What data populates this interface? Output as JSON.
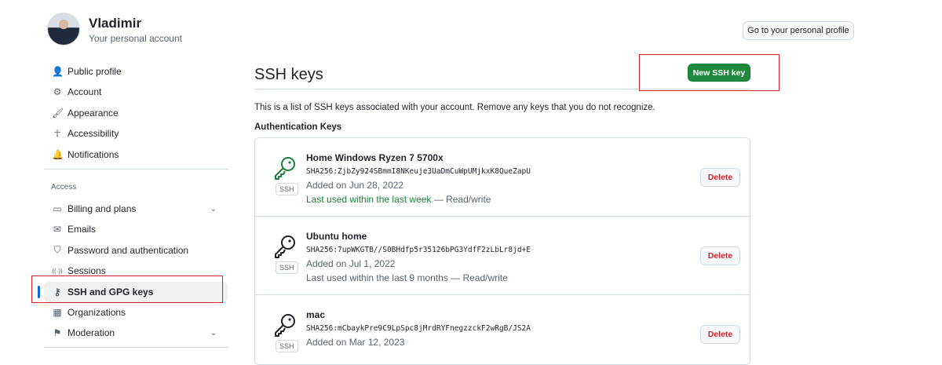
{
  "user": {
    "name": "Vladimir",
    "subtitle": "Your personal account"
  },
  "header": {
    "profile_button": "Go to your personal profile"
  },
  "sidebar": {
    "items": [
      {
        "label": "Public profile",
        "icon": "person-icon"
      },
      {
        "label": "Account",
        "icon": "gear-icon"
      },
      {
        "label": "Appearance",
        "icon": "paintbrush-icon"
      },
      {
        "label": "Accessibility",
        "icon": "accessibility-icon"
      },
      {
        "label": "Notifications",
        "icon": "bell-icon"
      }
    ],
    "section_label": "Access",
    "access_items": [
      {
        "label": "Billing and plans",
        "icon": "credit-card-icon"
      },
      {
        "label": "Emails",
        "icon": "mail-icon"
      },
      {
        "label": "Password and authentication",
        "icon": "shield-lock-icon"
      },
      {
        "label": "Sessions",
        "icon": "broadcast-icon"
      },
      {
        "label": "SSH and GPG keys",
        "icon": "key-icon"
      },
      {
        "label": "Organizations",
        "icon": "organization-icon"
      },
      {
        "label": "Moderation",
        "icon": "report-icon"
      }
    ]
  },
  "main": {
    "title": "SSH keys",
    "new_button": "New SSH key",
    "description": "This is a list of SSH keys associated with your account. Remove any keys that you do not recognize.",
    "section": "Authentication Keys",
    "keys": [
      {
        "title": "Home Windows Ryzen 7 5700x",
        "fingerprint": "SHA256:ZjbZy924SBmmI8NKeuje3UaDmCuWpUMjkxK8QueZapU",
        "added": "Added on Jun 28, 2022",
        "used": "Last used within the last week",
        "access": " — Read/write",
        "badge": "SSH",
        "delete": "Delete",
        "color": "#1a7f37"
      },
      {
        "title": "Ubuntu home",
        "fingerprint": "SHA256:7upWKGTB//S0BHdfp5r35126bPG3YdfF2zLbLr8jd+E",
        "added": "Added on Jul 1, 2022",
        "used": "Last used within the last 9 months",
        "access": " — Read/write",
        "badge": "SSH",
        "delete": "Delete",
        "color": "#1f2328"
      },
      {
        "title": "mac",
        "fingerprint": "SHA256:mCbaykPre9C9LpSpc8jMrdRYFnegzzckF2wRgB/JS2A",
        "added": "Added on Mar 12, 2023",
        "badge": "SSH",
        "delete": "Delete",
        "color": "#1f2328"
      }
    ]
  },
  "colors": {
    "primary": "#1f883d",
    "danger": "#cf222e",
    "accent": "#0969da"
  }
}
